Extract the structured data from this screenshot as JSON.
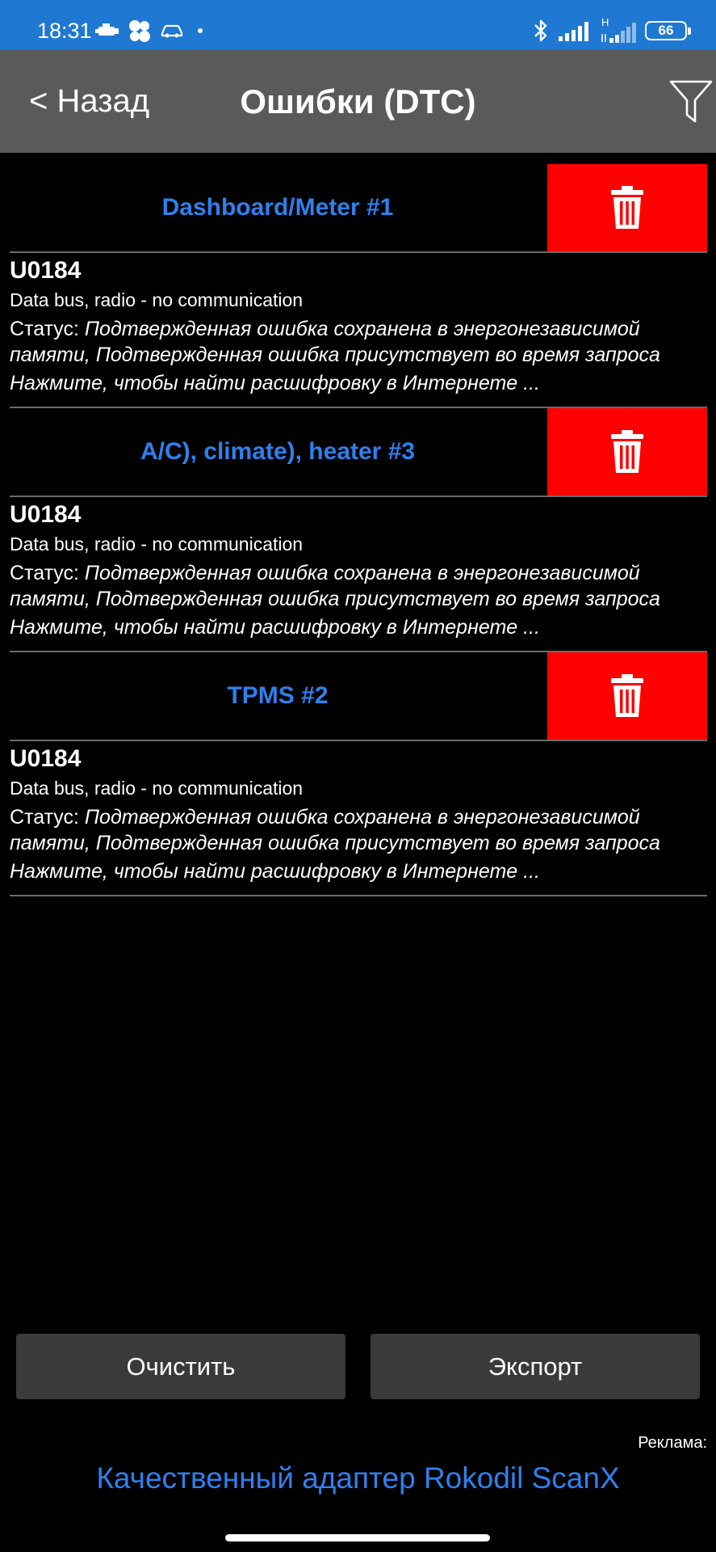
{
  "status_bar": {
    "time": "18:31",
    "left_icons": [
      "engine-icon",
      "cluster-icon",
      "car-icon",
      "dot-icon"
    ],
    "right_icons": [
      "bluetooth-icon",
      "signal-icon",
      "signal-h-icon",
      "battery-icon"
    ],
    "network_label": "H",
    "battery": "66"
  },
  "header": {
    "back_label": "< Назад",
    "title": "Ошибки (DTC)",
    "filter_icon": "filter-icon"
  },
  "groups": [
    {
      "title": "Dashboard/Meter #1",
      "code": "U0184",
      "description": "Data bus, radio - no communication",
      "status_prefix": "Статус: ",
      "status_text": "Подтвержденная ошибка сохранена в энергонезависимой памяти, Подтвержденная ошибка присутствует во время запроса",
      "hint": "Нажмите, чтобы найти расшифровку в Интернете ..."
    },
    {
      "title": "A/C), climate), heater #3",
      "code": "U0184",
      "description": "Data bus, radio - no communication",
      "status_prefix": "Статус: ",
      "status_text": "Подтвержденная ошибка сохранена в энергонезависимой памяти, Подтвержденная ошибка присутствует во время запроса",
      "hint": "Нажмите, чтобы найти расшифровку в Интернете ..."
    },
    {
      "title": "TPMS #2",
      "code": "U0184",
      "description": "Data bus, radio - no communication",
      "status_prefix": "Статус: ",
      "status_text": "Подтвержденная ошибка сохранена в энергонезависимой памяти, Подтвержденная ошибка присутствует во время запроса",
      "hint": "Нажмите, чтобы найти расшифровку в Интернете ..."
    }
  ],
  "footer": {
    "clear_label": "Очистить",
    "export_label": "Экспорт"
  },
  "ad": {
    "label": "Реклама:",
    "text": "Качественный адаптер Rokodil ScanX"
  },
  "colors": {
    "status_bar": "#1f78d1",
    "app_bar": "#5a5a5a",
    "accent": "#2f80ed",
    "delete": "#ff0000",
    "button": "#3a3a3a"
  }
}
